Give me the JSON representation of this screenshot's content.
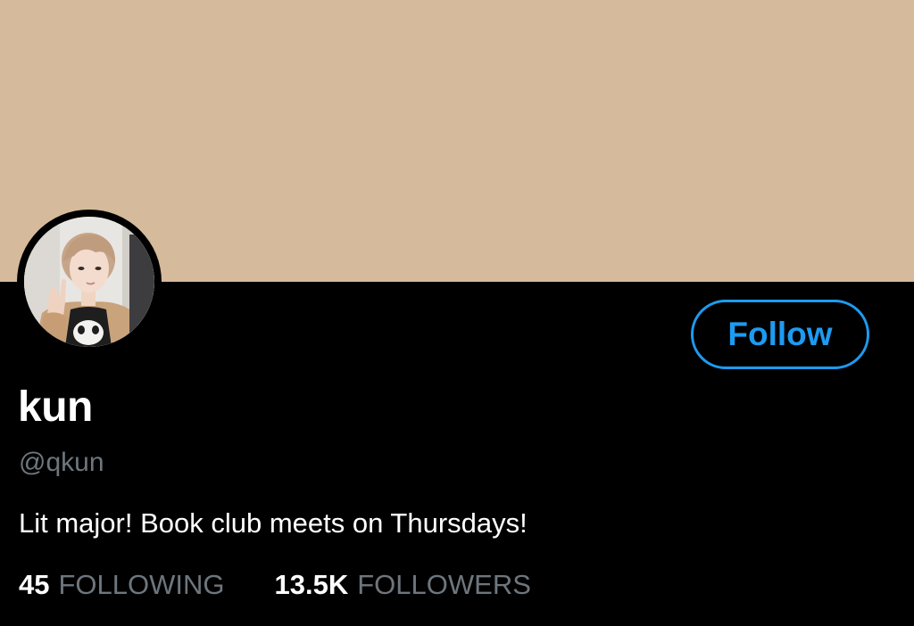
{
  "profile": {
    "display_name": "kun",
    "handle": "@qkun",
    "bio": "Lit major! Book club meets on Thursdays!",
    "banner_color": "#d5ba9b"
  },
  "actions": {
    "follow_label": "Follow"
  },
  "stats": {
    "following_count": "45",
    "following_label": "FOLLOWING",
    "followers_count": "13.5K",
    "followers_label": "FOLLOWERS"
  },
  "colors": {
    "background": "#000000",
    "accent": "#1d9bf0",
    "secondary_text": "#6e767d",
    "primary_text": "#ffffff"
  }
}
